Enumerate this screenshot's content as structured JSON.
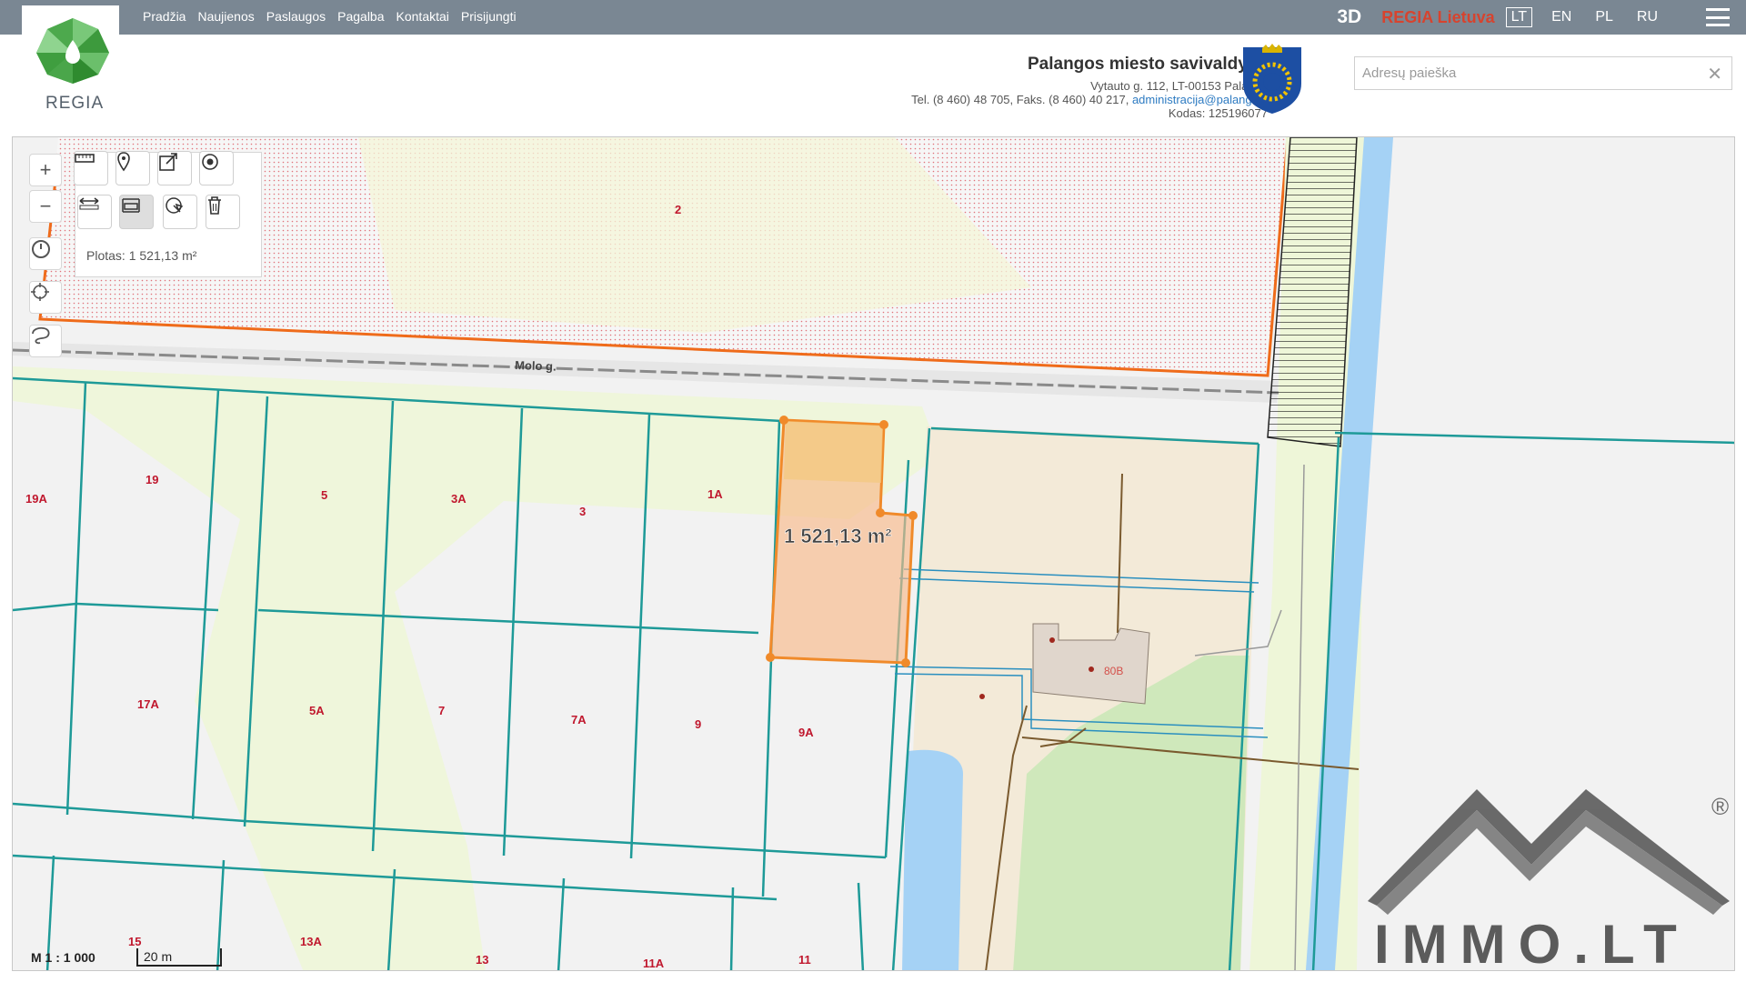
{
  "nav": {
    "links": [
      "Pradžia",
      "Naujienos",
      "Paslaugos",
      "Pagalba",
      "Kontaktai",
      "Prisijungti"
    ],
    "btn_3d": "3D",
    "regia_lietuva": "REGIA Lietuva",
    "languages": [
      "LT",
      "EN",
      "PL",
      "RU"
    ],
    "active_language": "LT"
  },
  "header": {
    "logo_text": "REGIA",
    "municipality": "Palangos miesto savivaldybė",
    "address": "Vytauto g. 112, LT-00153 Palanga",
    "phone_prefix": "Tel. (8 460) 48 705, Faks. (8 460) 40 217,",
    "email": "administracija@palanga.lt",
    "code": "Kodas: 125196077"
  },
  "search": {
    "placeholder": "Adresų paieška"
  },
  "map": {
    "area_info": "Plotas: 1 521,13 m²",
    "measured_area": "1 521,13 m²",
    "street": "Molo g.",
    "scale": "M 1 : 1 000",
    "scale_bar": "20 m",
    "parcels": [
      "2",
      "19A",
      "19",
      "5",
      "3A",
      "3",
      "1A",
      "17A",
      "5A",
      "7",
      "7A",
      "9",
      "9A",
      "15",
      "13A",
      "13",
      "11A",
      "11",
      "80B"
    ],
    "watermark_text": "IMMO.LT",
    "watermark_mark": "®"
  },
  "colors": {
    "topbar": "#7a8793",
    "accent_red": "#d7432e",
    "selection_orange": "#f08a2a",
    "parcel_line": "#1e9a98",
    "water": "#a5d2f5"
  }
}
